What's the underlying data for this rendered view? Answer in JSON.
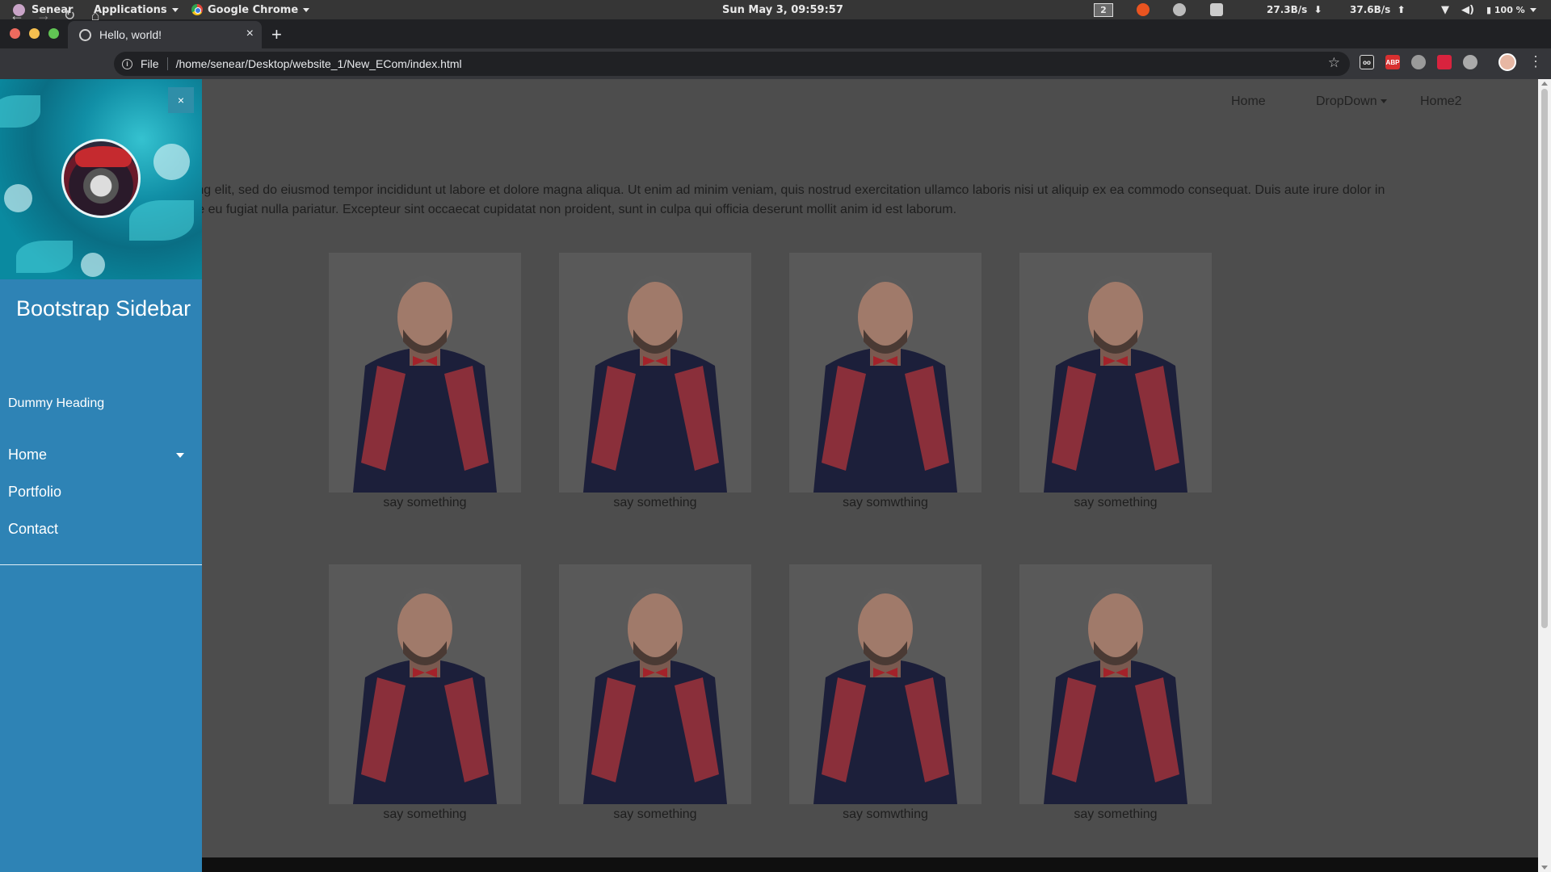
{
  "os_panel": {
    "user": "Senear",
    "applications": "Applications",
    "active_app": "Google Chrome",
    "clock": "Sun May  3, 09:59:57",
    "workspace": "2",
    "net_down": "27.3B/s",
    "net_up": "37.6B/s",
    "battery": "100 %"
  },
  "browser": {
    "tab_title": "Hello, world!",
    "new_tab": "+",
    "tab_close": "×",
    "address_scheme": "File",
    "address_url": "/home/senear/Desktop/website_1/New_ECom/index.html",
    "extensions": [
      "tab-ext-icon",
      "adblock-plus-icon",
      "globe-ext-icon",
      "red-ext-icon",
      "settings-ext-icon"
    ]
  },
  "page": {
    "nav": {
      "home": "Home",
      "dropdown": "DropDown",
      "home2": "Home2"
    },
    "lorem_line1": "tetur adipisicing elit, sed do eiusmod tempor incididunt ut labore et dolore magna aliqua. Ut enim ad minim veniam, quis nostrud exercitation ullamco laboris nisi ut aliquip ex ea commodo consequat. Duis aute irure dolor in",
    "lorem_line2": "e cillum dolore eu fugiat nulla pariatur. Excepteur sint occaecat cupidatat non proident, sunt in culpa qui officia deserunt mollit anim id est laborum.",
    "gallery": [
      {
        "caption": "say something"
      },
      {
        "caption": "say something"
      },
      {
        "caption": "say somwthing"
      },
      {
        "caption": "say something"
      },
      {
        "caption": "say something"
      },
      {
        "caption": "say something"
      },
      {
        "caption": "say somwthing"
      },
      {
        "caption": "say something"
      }
    ]
  },
  "sidebar": {
    "close": "×",
    "title": "Bootstrap Sidebar",
    "dummy_heading": "Dummy Heading",
    "items": [
      {
        "label": "Home",
        "has_submenu": true
      },
      {
        "label": "Portfolio",
        "has_submenu": false
      },
      {
        "label": "Contact",
        "has_submenu": false
      }
    ]
  },
  "colors": {
    "sidebar_bg": "#2e83b5",
    "overlay_bg": "#4d4d4d",
    "footer": "#0f0f0f"
  }
}
